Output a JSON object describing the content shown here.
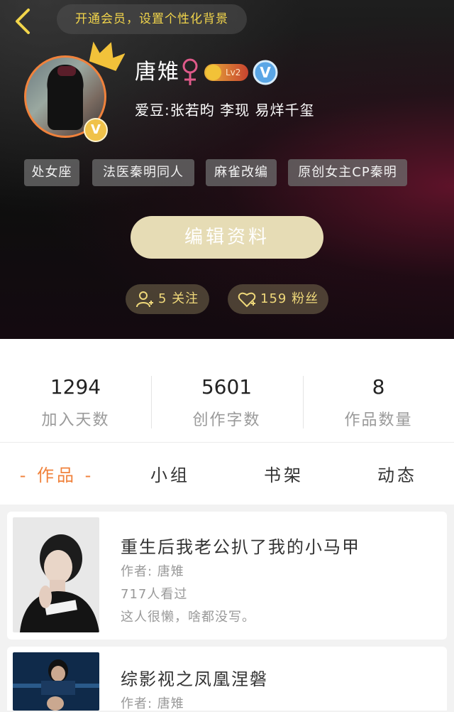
{
  "header": {
    "vip_banner": "开通会员，设置个性化背景",
    "username": "唐雉",
    "level": "Lv2",
    "verified_mark": "V",
    "avatar_badge": "V",
    "idols": "爱豆:张若昀 李现 易烊千玺",
    "tags": [
      "处女座",
      "法医秦明同人",
      "麻雀改编",
      "原创女主CP秦明"
    ],
    "edit_button": "编辑资料",
    "follow_text": "5 关注",
    "fans_text": "159 粉丝",
    "icons": {
      "back": "back-arrow-icon",
      "crown": "crown-icon",
      "gender": "female-icon",
      "verified": "verified-icon",
      "follow": "add-user-icon",
      "fans": "heart-icon"
    }
  },
  "stats": [
    {
      "value": "1294",
      "label": "加入天数"
    },
    {
      "value": "5601",
      "label": "创作字数"
    },
    {
      "value": "8",
      "label": "作品数量"
    }
  ],
  "tabs": [
    {
      "label": "- 作品 -",
      "active": true
    },
    {
      "label": "小组",
      "active": false
    },
    {
      "label": "书架",
      "active": false
    },
    {
      "label": "动态",
      "active": false
    }
  ],
  "works": [
    {
      "title": "重生后我老公扒了我的小马甲",
      "author": "作者: 唐雉",
      "views": "717人看过",
      "description": "这人很懒，啥都没写。"
    },
    {
      "title": "综影视之凤凰涅磐",
      "author": "作者: 唐雉"
    }
  ],
  "colors": {
    "accent": "#f0823c",
    "gold": "#efd87a",
    "edit_button": "#e6dcb5"
  }
}
